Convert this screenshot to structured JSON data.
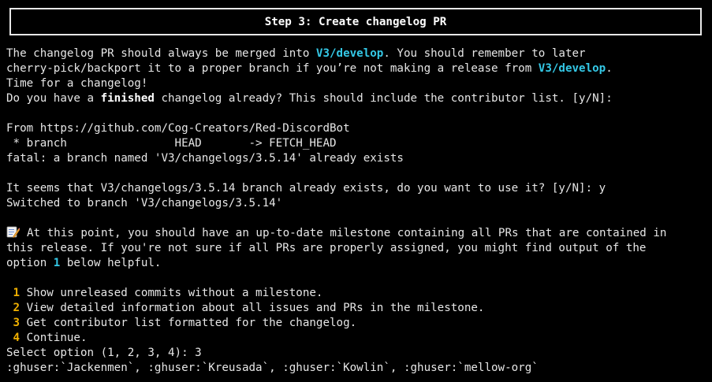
{
  "header": {
    "title": "Step 3: Create changelog PR"
  },
  "intro": {
    "l1_a": "The changelog PR should always be merged into ",
    "branch": "V3/develop",
    "l1_b": ". You should remember to later",
    "l2_a": "cherry-pick/backport it to a proper branch if you’re not making a release from ",
    "l2_b": ".",
    "l3": "Time for a changelog!",
    "l4_a": "Do you have a ",
    "l4_bold": "finished",
    "l4_b": " changelog already? This should include the contributor list. [y/N]:"
  },
  "git_output": {
    "from": "From https://github.com/Cog-Creators/Red-DiscordBot",
    "branch_line": " * branch                HEAD       -> FETCH_HEAD",
    "fatal": "fatal: a branch named 'V3/changelogs/3.5.14' already exists"
  },
  "existing_branch": {
    "prompt": "It seems that V3/changelogs/3.5.14 branch already exists, do you want to use it? [y/N]: y",
    "switched": "Switched to branch 'V3/changelogs/3.5.14'"
  },
  "milestone_note": {
    "icon": "memo-icon",
    "l1": "At this point, you should have an up-to-date milestone containing all PRs that are contained in",
    "l2": "this release. If you're not sure if all PRs are properly assigned, you might find output of the",
    "l3_a": "option ",
    "l3_num": "1",
    "l3_b": " below helpful."
  },
  "menu": {
    "options": [
      {
        "num": "1",
        "label": "Show unreleased commits without a milestone."
      },
      {
        "num": "2",
        "label": "View detailed information about all issues and PRs in the milestone."
      },
      {
        "num": "3",
        "label": "Get contributor list formatted for the changelog."
      },
      {
        "num": "4",
        "label": "Continue."
      }
    ],
    "select_prompt": "Select option (1, 2, 3, 4): 3"
  },
  "contributors": ":ghuser:`Jackenmen`, :ghuser:`Kreusada`, :ghuser:`Kowlin`, :ghuser:`mellow-org`",
  "colors": {
    "background": "#000000",
    "text": "#e6e6e6",
    "branch_highlight": "#34c8e6",
    "option_number": "#f0b000"
  }
}
